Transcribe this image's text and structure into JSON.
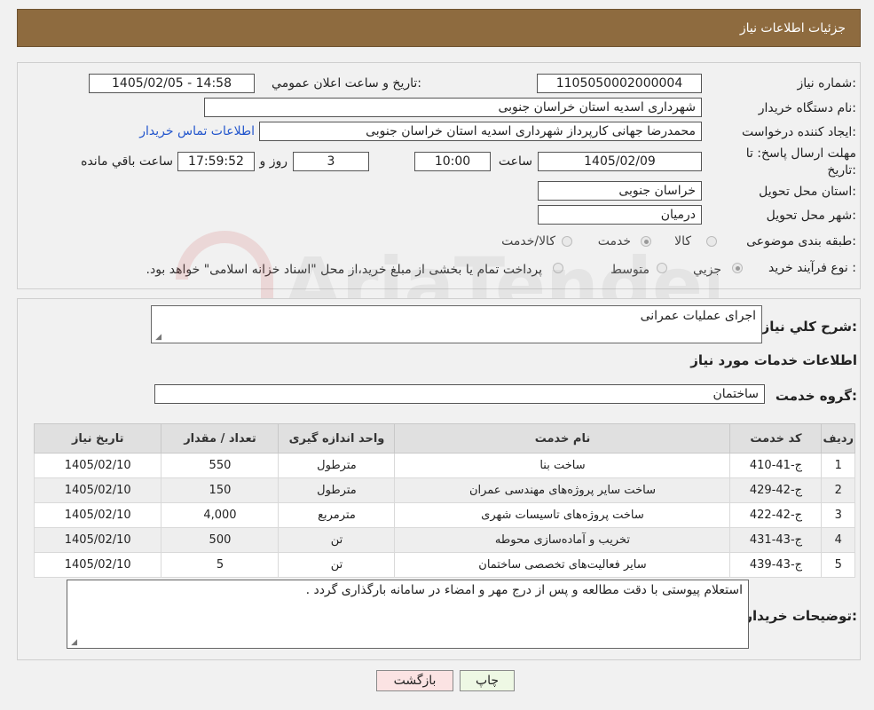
{
  "header": {
    "title": "جزئیات اطلاعات نیاز"
  },
  "form": {
    "need_number": {
      "label": "شماره نیاز:",
      "value": "1105050002000004"
    },
    "announce": {
      "label": "تاريخ و ساعت اعلان عمومي:",
      "value": "1405/02/05 - 14:58"
    },
    "buyer_org": {
      "label": "نام دستگاه خريدار:",
      "value": "شهرداری اسدیه استان خراسان جنوبی"
    },
    "creator": {
      "label": "ايجاد کننده درخواست:",
      "value": "محمدرضا جهانی کارپرداز شهرداری اسدیه استان خراسان جنوبی",
      "contact_link": "اطلاعات تماس خريدار"
    },
    "deadline": {
      "label_line1": "مهلت ارسال پاسخ: تا",
      "label_line2": "تاريخ:",
      "date": "1405/02/09",
      "time_label": "ساعت",
      "time": "10:00",
      "days": "3",
      "days_label": "روز و",
      "remaining": "17:59:52",
      "remaining_label": "ساعت باقي مانده"
    },
    "province": {
      "label": "استان محل تحويل:",
      "value": "خراسان جنوبی"
    },
    "city": {
      "label": "شهر محل تحويل:",
      "value": "درمیان"
    },
    "category": {
      "label": "طبقه بندی موضوعی:",
      "options": [
        "کالا",
        "خدمت",
        "کالا/خدمت"
      ],
      "selected": "خدمت"
    },
    "process": {
      "label": "نوع فرآيند خريد :",
      "options": [
        "جزيي",
        "متوسط"
      ],
      "selected": "جزيي",
      "note": "پرداخت تمام يا بخشی از مبلغ خريد،از محل \"اسناد خزانه اسلامی\" خواهد بود."
    }
  },
  "details": {
    "summary_label": "شرح کلي نياز:",
    "summary_value": "اجرای عملیات عمرانی",
    "services_title": "اطلاعات خدمات مورد نياز",
    "group_label": "گروه خدمت:",
    "group_value": "ساختمان"
  },
  "table": {
    "headers": [
      "رديف",
      "کد خدمت",
      "نام خدمت",
      "واحد اندازه گيری",
      "تعداد / مقدار",
      "تاريخ نياز"
    ],
    "rows": [
      [
        "1",
        "ج-41-410",
        "ساخت بنا",
        "مترطول",
        "550",
        "1405/02/10"
      ],
      [
        "2",
        "ج-42-429",
        "ساخت سایر پروژه‌های مهندسی عمران",
        "مترطول",
        "150",
        "1405/02/10"
      ],
      [
        "3",
        "ج-42-422",
        "ساخت پروژه‌های تاسیسات شهری",
        "مترمربع",
        "4,000",
        "1405/02/10"
      ],
      [
        "4",
        "ج-43-431",
        "تخریب و آماده‌سازی محوطه",
        "تن",
        "500",
        "1405/02/10"
      ],
      [
        "5",
        "ج-43-439",
        "سایر فعالیت‌های تخصصی ساختمان",
        "تن",
        "5",
        "1405/02/10"
      ]
    ]
  },
  "buyer_notes": {
    "label": "توضيحات خريدار:",
    "value": "استعلام پیوستی با دقت مطالعه و پس از درج مهر و امضاء در سامانه بارگذاری گردد ."
  },
  "buttons": {
    "print": "چاپ",
    "back": "بازگشت"
  },
  "watermark": {
    "text": "AriaTender.neT"
  },
  "colors": {
    "header_bg": "#8e6b3f",
    "link": "#2255cc",
    "print_btn": "#eef8e4",
    "back_btn": "#fbe3e3"
  }
}
